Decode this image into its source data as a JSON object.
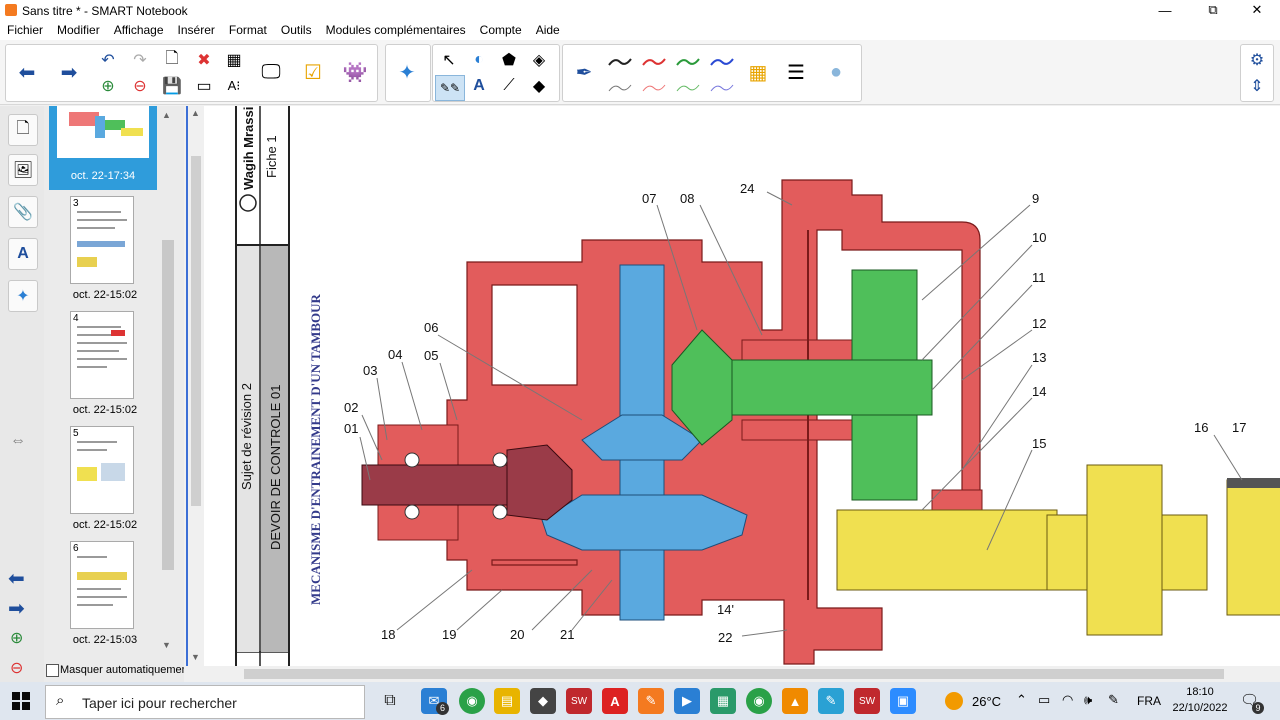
{
  "window": {
    "title": "Sans titre * - SMART Notebook",
    "controls": {
      "minimize": "—",
      "maximize": "⧉",
      "close": "✕"
    }
  },
  "menu": [
    "Fichier",
    "Modifier",
    "Affichage",
    "Insérer",
    "Format",
    "Outils",
    "Modules complémentaires",
    "Compte",
    "Aide"
  ],
  "sorter": {
    "pages": [
      {
        "num": "",
        "caption": "oct. 22-17:34",
        "selected": true
      },
      {
        "num": "3",
        "caption": "oct. 22-15:02"
      },
      {
        "num": "4",
        "caption": "oct. 22-15:02"
      },
      {
        "num": "5",
        "caption": "oct. 22-15:02"
      },
      {
        "num": "6",
        "caption": "oct. 22-15:03"
      }
    ],
    "autohide_label": "Masquer automatiquement"
  },
  "page": {
    "author": "Wagih Mrassi",
    "sheet": "Fiche 1",
    "revision": "Sujet de révision 2",
    "exam": "DEVOIR DE CONTROLE 01",
    "subject": "MECANISME D'ENTRAINEMENT D'UN TAMBOUR",
    "labels": [
      "07",
      "08",
      "24",
      "9",
      "10",
      "11",
      "12",
      "13",
      "14",
      "15",
      "16",
      "17",
      "06",
      "04",
      "05",
      "03",
      "02",
      "01",
      "18",
      "19",
      "20",
      "21",
      "14'",
      "22"
    ]
  },
  "taskbar": {
    "search_placeholder": "Taper ici pour rechercher",
    "weather": "26°C",
    "language": "FRA",
    "time": "18:10",
    "date": "22/10/2022",
    "mail_badge": "6",
    "notification_badge": "9"
  },
  "colors": {
    "accent": "#3c6fd6",
    "red_part": "#e05555",
    "blue_part": "#5aa9df",
    "green_part": "#4fbf5a",
    "yellow_part": "#f0e050",
    "maroon_part": "#9a3b48"
  }
}
